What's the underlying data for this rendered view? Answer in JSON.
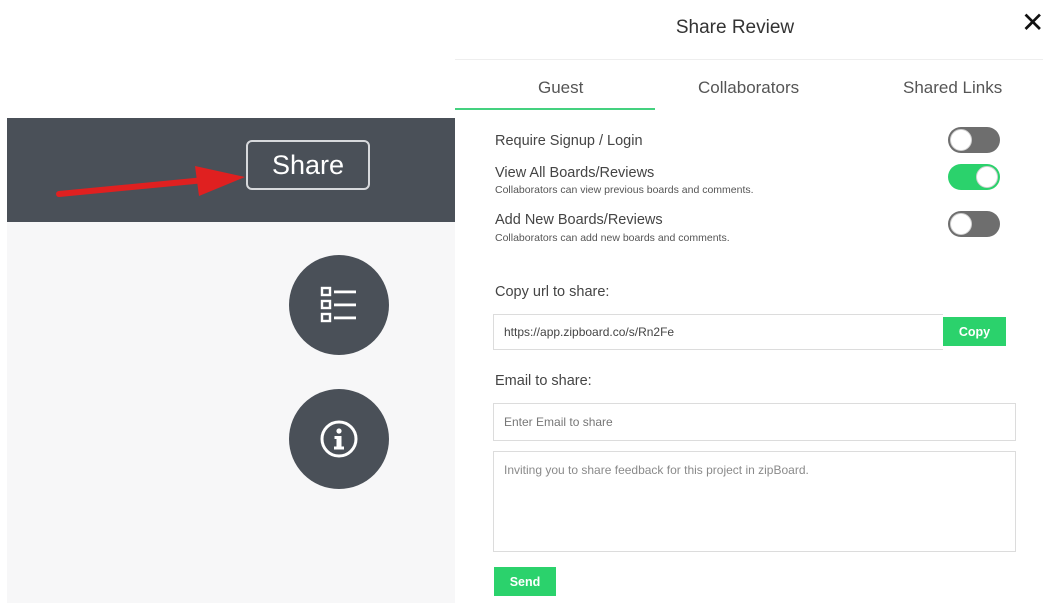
{
  "background_app": {
    "share_button_label": "Share",
    "list_button_icon": "checklist-icon",
    "info_button_icon": "info-icon",
    "annotation_arrow_color": "#e02020",
    "header_color": "#4a5058"
  },
  "modal": {
    "title": "Share Review",
    "close_icon": "close-icon",
    "tabs": [
      {
        "label": "Guest",
        "active": true
      },
      {
        "label": "Collaborators",
        "active": false
      },
      {
        "label": "Shared Links",
        "active": false
      }
    ],
    "settings": [
      {
        "title": "Require Signup / Login",
        "description": "",
        "enabled": false
      },
      {
        "title": "View All Boards/Reviews",
        "description": "Collaborators can view previous boards and comments.",
        "enabled": true
      },
      {
        "title": "Add New Boards/Reviews",
        "description": "Collaborators can add new boards and comments.",
        "enabled": false
      }
    ],
    "copy_url": {
      "label": "Copy url to share:",
      "value": "https://app.zipboard.co/s/Rn2Fe",
      "button_label": "Copy"
    },
    "email": {
      "label": "Email to share:",
      "placeholder": "Enter Email to share",
      "message_placeholder": "Inviting you to share feedback for this project in zipBoard.",
      "send_label": "Send"
    },
    "accent_color": "#2bd26c"
  }
}
